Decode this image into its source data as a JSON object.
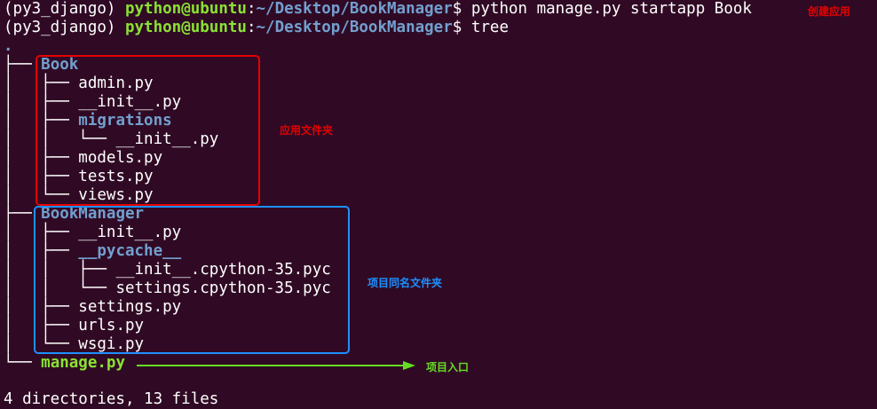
{
  "terminal": {
    "prompt_env": "(py3_django)",
    "prompt_user": "python@ubuntu",
    "prompt_sep": ":",
    "prompt_path": "~/Desktop/BookManager",
    "prompt_dollar": "$",
    "commands": [
      "python manage.py startapp Book",
      "tree"
    ],
    "root": ".",
    "summary": "4 directories, 13 files"
  },
  "tree_lines": [
    {
      "prefix": "├── ",
      "name": "Book",
      "kind": "dir"
    },
    {
      "prefix": "│   ├── ",
      "name": "admin.py",
      "kind": "file"
    },
    {
      "prefix": "│   ├── ",
      "name": "__init__.py",
      "kind": "file"
    },
    {
      "prefix": "│   ├── ",
      "name": "migrations",
      "kind": "dir"
    },
    {
      "prefix": "│   │   └── ",
      "name": "__init__.py",
      "kind": "file"
    },
    {
      "prefix": "│   ├── ",
      "name": "models.py",
      "kind": "file"
    },
    {
      "prefix": "│   ├── ",
      "name": "tests.py",
      "kind": "file"
    },
    {
      "prefix": "│   └── ",
      "name": "views.py",
      "kind": "file"
    },
    {
      "prefix": "├── ",
      "name": "BookManager",
      "kind": "dir"
    },
    {
      "prefix": "│   ├── ",
      "name": "__init__.py",
      "kind": "file"
    },
    {
      "prefix": "│   ├── ",
      "name": "__pycache__",
      "kind": "dir"
    },
    {
      "prefix": "│   │   ├── ",
      "name": "__init__.cpython-35.pyc",
      "kind": "file"
    },
    {
      "prefix": "│   │   └── ",
      "name": "settings.cpython-35.pyc",
      "kind": "file"
    },
    {
      "prefix": "│   ├── ",
      "name": "settings.py",
      "kind": "file"
    },
    {
      "prefix": "│   ├── ",
      "name": "urls.py",
      "kind": "file"
    },
    {
      "prefix": "│   └── ",
      "name": "wsgi.py",
      "kind": "file"
    },
    {
      "prefix": "└── ",
      "name": "manage.py",
      "kind": "exec"
    }
  ],
  "annotations": {
    "create_app": "创建应用",
    "app_folder": "应用文件夹",
    "project_folder": "项目同名文件夹",
    "entry": "项目入口"
  },
  "colors": {
    "background": "#300a24",
    "red": "#e60000",
    "blue": "#1e90ff",
    "green": "#66dd22"
  }
}
